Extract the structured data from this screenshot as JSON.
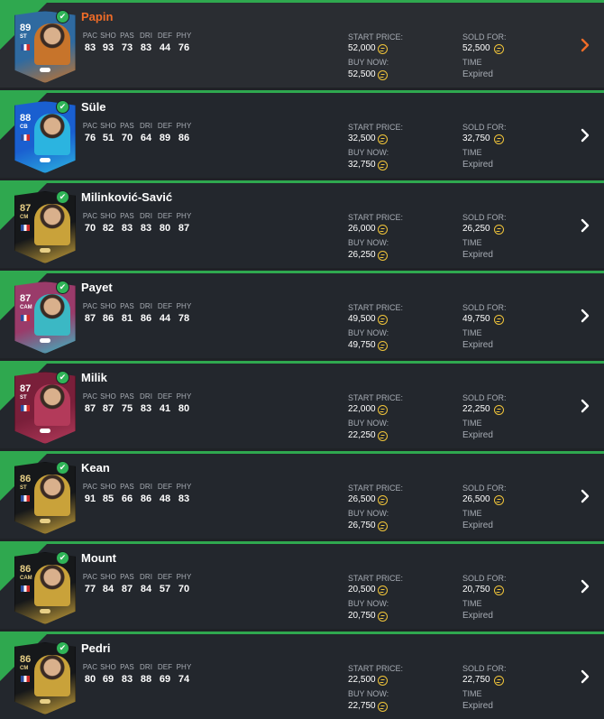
{
  "stat_labels": [
    "PAC",
    "SHO",
    "PAS",
    "DRI",
    "DEF",
    "PHY"
  ],
  "labels": {
    "start_price": "START PRICE:",
    "buy_now": "BUY NOW:",
    "sold_for": "SOLD FOR:",
    "time": "TIME"
  },
  "colors": {
    "accent_green": "#2fa84f",
    "active_name": "#f06c28",
    "coin": "#f0c43a",
    "label_grey": "#a6abb3"
  },
  "items": [
    {
      "name": "Papin",
      "rating": "89",
      "position": "ST",
      "stats": [
        "83",
        "93",
        "73",
        "83",
        "44",
        "76"
      ],
      "start_price": "52,000",
      "buy_now": "52,500",
      "sold_for": "52,500",
      "time": "Expired",
      "active": true,
      "card_color": "#2f6aa0",
      "card_color2": "#c7742b"
    },
    {
      "name": "Süle",
      "rating": "88",
      "position": "CB",
      "stats": [
        "76",
        "51",
        "70",
        "64",
        "89",
        "86"
      ],
      "start_price": "32,500",
      "buy_now": "32,750",
      "sold_for": "32,750",
      "time": "Expired",
      "active": false,
      "card_color": "#1a5fd0",
      "card_color2": "#2bb4e0"
    },
    {
      "name": "Milinković-Savić",
      "rating": "87",
      "position": "CM",
      "stats": [
        "70",
        "82",
        "83",
        "83",
        "80",
        "87"
      ],
      "start_price": "26,000",
      "buy_now": "26,250",
      "sold_for": "26,250",
      "time": "Expired",
      "active": false,
      "card_color": "#16181a",
      "card_color2": "#c9a23a"
    },
    {
      "name": "Payet",
      "rating": "87",
      "position": "CAM",
      "stats": [
        "87",
        "86",
        "81",
        "86",
        "44",
        "78"
      ],
      "start_price": "49,500",
      "buy_now": "49,750",
      "sold_for": "49,750",
      "time": "Expired",
      "active": false,
      "card_color": "#9a3b6a",
      "card_color2": "#3bb8c4"
    },
    {
      "name": "Milik",
      "rating": "87",
      "position": "ST",
      "stats": [
        "87",
        "87",
        "75",
        "83",
        "41",
        "80"
      ],
      "start_price": "22,000",
      "buy_now": "22,250",
      "sold_for": "22,250",
      "time": "Expired",
      "active": false,
      "card_color": "#7a1f3a",
      "card_color2": "#b33a5a"
    },
    {
      "name": "Kean",
      "rating": "86",
      "position": "ST",
      "stats": [
        "91",
        "85",
        "66",
        "86",
        "48",
        "83"
      ],
      "start_price": "26,500",
      "buy_now": "26,750",
      "sold_for": "26,500",
      "time": "Expired",
      "active": false,
      "card_color": "#16181a",
      "card_color2": "#c9a23a"
    },
    {
      "name": "Mount",
      "rating": "86",
      "position": "CAM",
      "stats": [
        "77",
        "84",
        "87",
        "84",
        "57",
        "70"
      ],
      "start_price": "20,500",
      "buy_now": "20,750",
      "sold_for": "20,750",
      "time": "Expired",
      "active": false,
      "card_color": "#16181a",
      "card_color2": "#c9a23a"
    },
    {
      "name": "Pedri",
      "rating": "86",
      "position": "CM",
      "stats": [
        "80",
        "69",
        "83",
        "88",
        "69",
        "74"
      ],
      "start_price": "22,500",
      "buy_now": "22,750",
      "sold_for": "22,750",
      "time": "Expired",
      "active": false,
      "card_color": "#16181a",
      "card_color2": "#c9a23a"
    }
  ]
}
